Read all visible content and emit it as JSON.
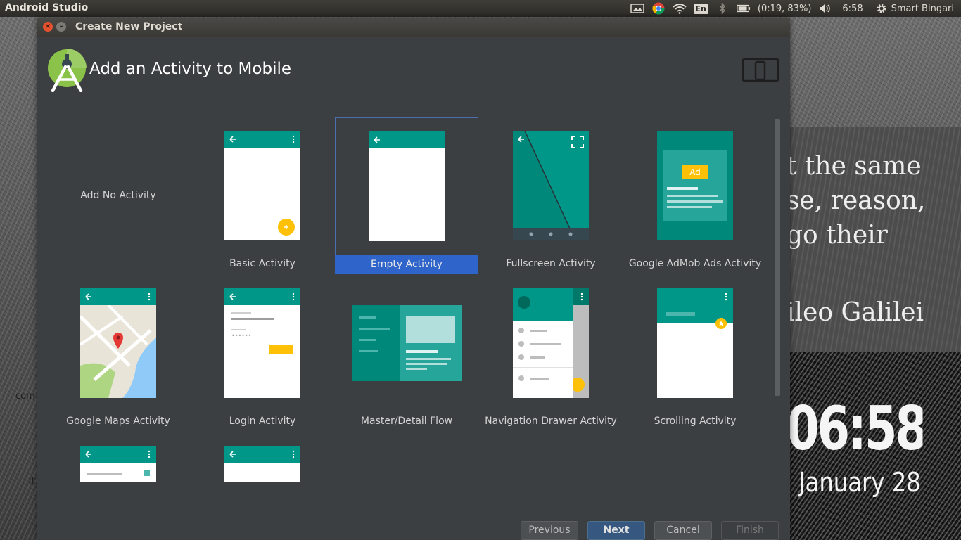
{
  "topbar": {
    "app_name": "Android Studio",
    "language": "En",
    "battery_text": "(0:19, 83%)",
    "time": "6:58",
    "user": "Smart Bingari"
  },
  "dialog": {
    "window_title": "Create New Project",
    "close_glyph": "×",
    "minimize_glyph": "–",
    "header_title": "Add an Activity to Mobile",
    "selected": "Empty Activity"
  },
  "activities": [
    {
      "label": "Add No Activity",
      "icon": "none"
    },
    {
      "label": "Basic Activity",
      "icon": "basic-activity-icon"
    },
    {
      "label": "Empty Activity",
      "icon": "empty-activity-icon"
    },
    {
      "label": "Fullscreen Activity",
      "icon": "fullscreen-activity-icon"
    },
    {
      "label": "Google AdMob Ads Activity",
      "icon": "admob-activity-icon",
      "badge": "Ad"
    },
    {
      "label": "Google Maps Activity",
      "icon": "maps-activity-icon"
    },
    {
      "label": "Login Activity",
      "icon": "login-activity-icon"
    },
    {
      "label": "Master/Detail Flow",
      "icon": "master-detail-icon"
    },
    {
      "label": "Navigation Drawer Activity",
      "icon": "nav-drawer-icon"
    },
    {
      "label": "Scrolling Activity",
      "icon": "scrolling-activity-icon"
    }
  ],
  "buttons": {
    "previous": "Previous",
    "next": "Next",
    "cancel": "Cancel",
    "finish": "Finish"
  },
  "desktop": {
    "quote_lines": [
      "t the same",
      "se, reason,",
      "go their"
    ],
    "quote_author": "ileo Galilei",
    "clock": "06:58",
    "date": "January 28",
    "frag_1": "com",
    "frag_2": "it"
  },
  "colors": {
    "teal": "#009688",
    "teal_dark": "#00796b",
    "accent": "#ffc107",
    "selection": "#2f65ca",
    "primary_button": "#365880"
  }
}
